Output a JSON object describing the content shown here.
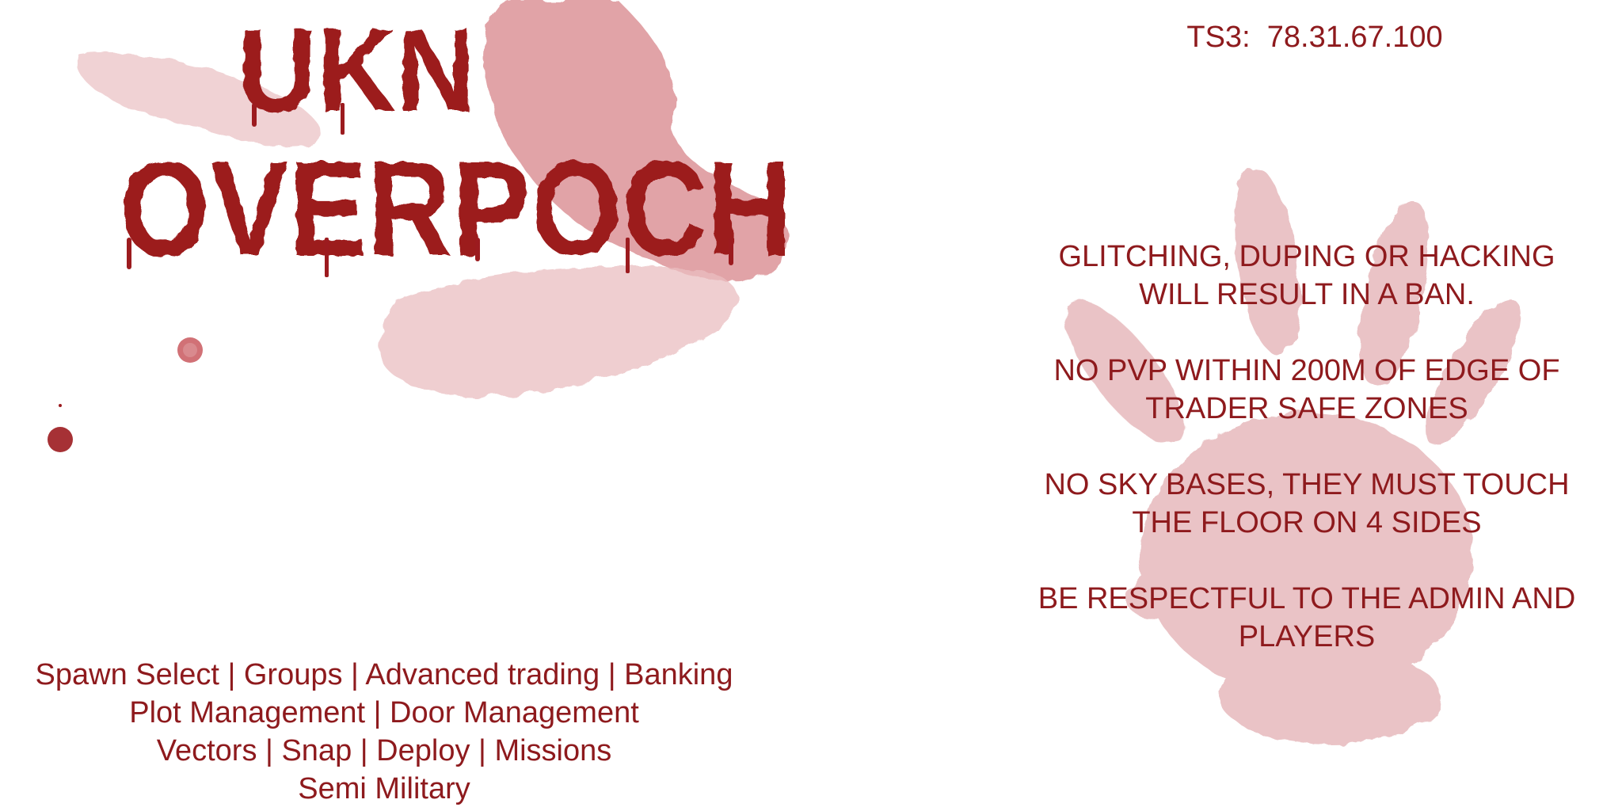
{
  "logo": {
    "line1": "UKN",
    "line2": "OVERPOCH"
  },
  "server": {
    "ts3": "TS3:  78.31.67.100"
  },
  "rules": [
    {
      "lines": [
        "GLITCHING, DUPING OR HACKING",
        "WILL RESULT IN A BAN."
      ]
    },
    {
      "lines": [
        "NO PVP WITHIN 200M OF EDGE OF",
        "TRADER SAFE ZONES"
      ]
    },
    {
      "lines": [
        "NO SKY BASES, THEY MUST TOUCH",
        "THE FLOOR ON 4 SIDES"
      ]
    },
    {
      "lines": [
        "BE RESPECTFUL TO THE ADMIN AND",
        "PLAYERS"
      ]
    }
  ],
  "features": [
    "Spawn Select | Groups | Advanced trading | Banking",
    "Plot Management | Door Management",
    "Vectors | Snap | Deploy | Missions",
    "Semi Military"
  ],
  "colors": {
    "text": "#8e1a1d",
    "blood": "#9c1b1f",
    "smear": "#c9585e",
    "background": "#ffffff"
  },
  "icons": {
    "handprint": "bloody-handprint-icon",
    "splatter": "blood-splatter-icon",
    "drop": "blood-drop-icon"
  }
}
